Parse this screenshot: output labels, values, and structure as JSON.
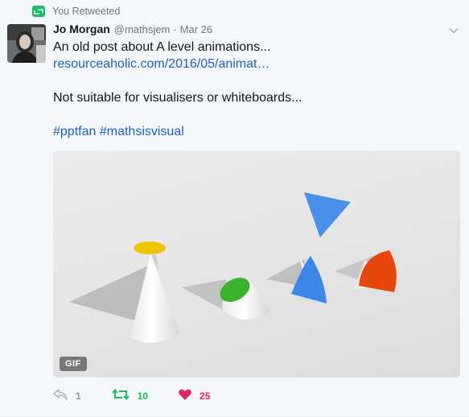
{
  "retweet_context": {
    "label": "You Retweeted",
    "icon": "retweet-icon"
  },
  "author": {
    "name": "Jo Morgan",
    "handle": "@mathsjem",
    "separator": "·",
    "date": "Mar 26"
  },
  "tweet": {
    "line1": "An old post about A level animations...",
    "link": "resourceaholic.com/2016/05/animat…",
    "line3": "Not suitable for visualisers or whiteboards...",
    "hashtag1": "#pptfan",
    "hashtag2": "#mathsisvisual"
  },
  "media": {
    "badge": "GIF"
  },
  "actions": {
    "reply_count": "1",
    "retweet_count": "10",
    "like_count": "25"
  },
  "colors": {
    "retweet_green": "#17bf63",
    "like_red": "#e0245e",
    "link_blue": "#1c5fd6",
    "muted": "#657786"
  }
}
